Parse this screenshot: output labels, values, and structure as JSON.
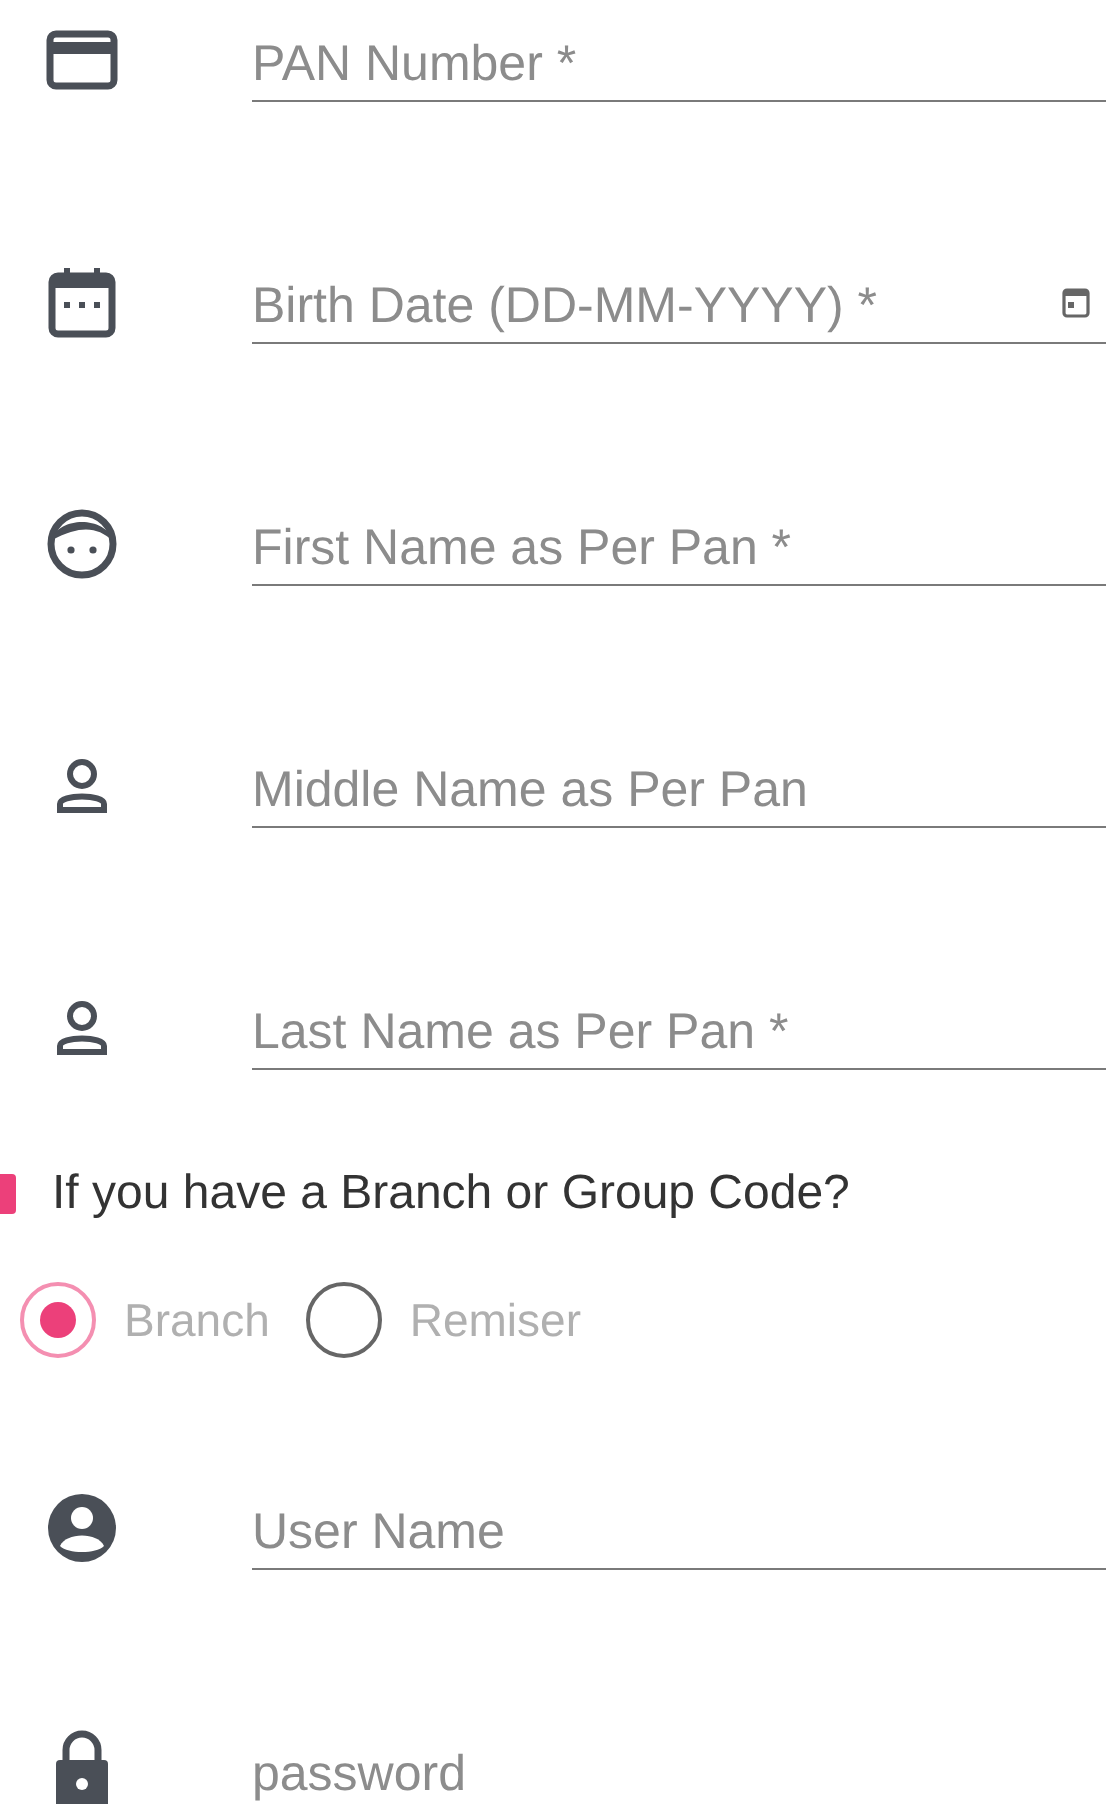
{
  "fields_top": [
    {
      "placeholder": "PAN Number *"
    },
    {
      "placeholder": "Birth Date (DD-MM-YYYY) *",
      "trailing_icon": true
    },
    {
      "placeholder": "First Name as Per Pan *"
    },
    {
      "placeholder": "Middle Name as Per Pan"
    },
    {
      "placeholder": "Last Name as Per Pan *"
    }
  ],
  "code_checkbox": {
    "label": "If you have a Branch or Group Code?",
    "checked": true
  },
  "code_type": [
    {
      "label": "Branch",
      "selected": true
    },
    {
      "label": "Remiser",
      "selected": false
    }
  ],
  "fields_login": [
    {
      "placeholder": "User Name"
    },
    {
      "placeholder": "password"
    }
  ]
}
